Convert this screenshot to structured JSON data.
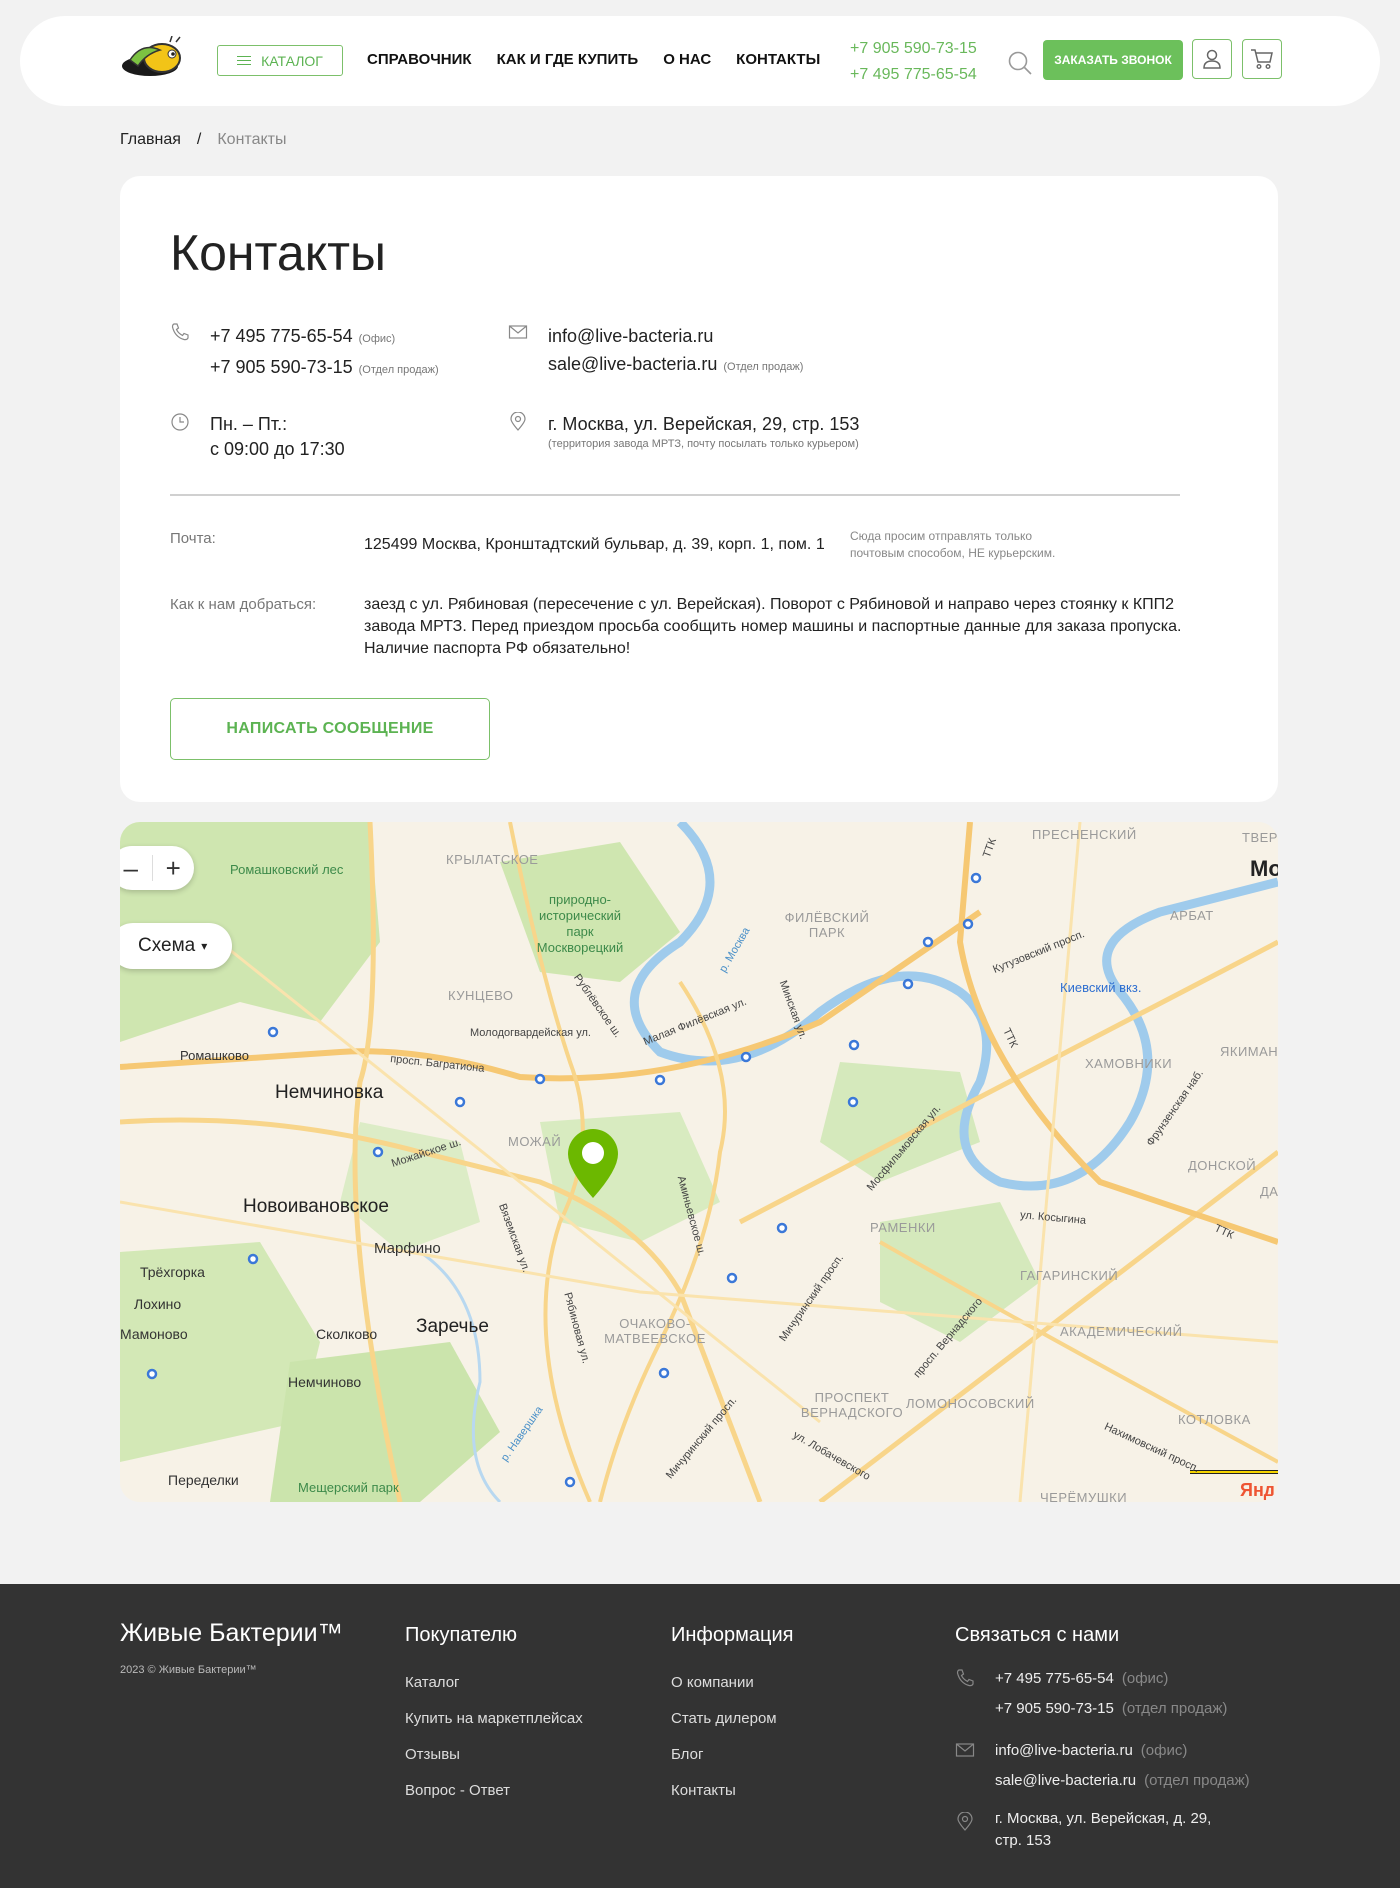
{
  "header": {
    "catalog_label": "КАТАЛОГ",
    "nav": [
      "СПРАВОЧНИК",
      "КАК И ГДЕ КУПИТЬ",
      "О НАС",
      "КОНТАКТЫ"
    ],
    "phones": [
      "+7 905 590-73-15",
      "+7 495 775-65-54"
    ],
    "call_label": "ЗАКАЗАТЬ ЗВОНОК"
  },
  "breadcrumb": {
    "home": "Главная",
    "sep": "/",
    "current": "Контакты"
  },
  "contacts": {
    "title": "Контакты",
    "phone1": "+7 495 775-65-54",
    "phone1_note": "(Офис)",
    "phone2": "+7 905 590-73-15",
    "phone2_note": "(Отдел продаж)",
    "email1": "info@live-bacteria.ru",
    "email2": "sale@live-bacteria.ru",
    "email2_note": "(Отдел продаж)",
    "hours1": "Пн. – Пт.:",
    "hours2": "с 09:00 до 17:30",
    "address": "г. Москва, ул. Верейская, 29, стр. 153",
    "address_note": "(территория завода МРТЗ, почту посылать только курьером)",
    "post_label": "Почта:",
    "post_value": "125499 Москва, Кронштадтский бульвар, д. 39, корп. 1, пом. 1",
    "post_note": "Сюда просим отправлять только почтовым способом, НЕ курьерским.",
    "route_label": "Как к нам добраться:",
    "route_value": "заезд с ул. Рябиновая (пересечение с ул. Верейская). Поворот с Рябиновой и направо через стоянку к КПП2 завода МРТЗ. Перед приездом просьба сообщить номер машины и паспортные данные для заказа пропуска. Наличие паспорта РФ обязательно!",
    "message_button": "НАПИСАТЬ СООБЩЕНИЕ"
  },
  "map": {
    "zoom_out": "–",
    "zoom_in": "+",
    "scheme_label": "Схема",
    "scheme_arrow": "▾",
    "labels": {
      "romashkovsky_les": "Ромашковский лес",
      "krylatskoe": "КРЫЛАТСКОЕ",
      "park": "природно-исторический парк Москворецкий",
      "presnensky": "ПРЕСНЕНСКИЙ",
      "tver": "ТВЕР",
      "mo": "Мо",
      "ttk1": "ТТК",
      "filevsky_park": "ФИЛЁВСКИЙ ПАРК",
      "arbat": "АРБАТ",
      "moskva_river": "р. Москва",
      "kutuzovsky": "Кутузовский просп.",
      "kievsky": "Киевский вкз.",
      "kuntsevo": "КУНЦЕВО",
      "rublevskoe": "Рублёвское ш.",
      "minskaya": "Минская ул.",
      "malaya_filevskaya": "Малая Филёвская ул.",
      "molodogvardeyskaya": "Молодогвардейская ул.",
      "ttk2": "ТТК",
      "yakiman": "ЯКИМАН",
      "romashkovo": "Ромашково",
      "bagrationa": "просп. Багратиона",
      "khamovniki": "ХАМОВНИКИ",
      "nemchinovka": "Немчиновка",
      "mozhaysky": "МОЖАЙ",
      "mozhayskoe": "Можайское ш.",
      "frunzenskaya": "Фрунзенская наб.",
      "donskoy": "ДОНСКОЙ",
      "novoivanovskoe": "Новоивановское",
      "mosfilmovskaya": "Мосфильмовская ул.",
      "aminyevskoe": "Аминьевское ш.",
      "vyazemskaya": "Вяземская ул.",
      "ramenki": "РАМЕНКИ",
      "kosygina": "ул. Косыгина",
      "ttk3": "ТТК",
      "da": "ДА",
      "marfino": "Марфино",
      "gagarinsky": "ГАГАРИНСКИЙ",
      "trekhgorka": "Трёхгорка",
      "lokhino": "Лохино",
      "michurinsky1": "Мичуринский просп.",
      "ryabinovaya": "Рябиновая ул.",
      "ochakovo": "ОЧАКОВО-МАТВЕЕВСКОЕ",
      "vernadskogo1": "просп. Вернадского",
      "akademichesky": "АКАДЕМИЧЕСКИЙ",
      "mamonovo": "Мамоново",
      "skolkovo": "Сколково",
      "zarechye": "Заречье",
      "nemchinovo": "Немчиново",
      "prospekt_vernadskogo": "ПРОСПЕКТ ВЕРНАДСКОГО",
      "lomonosovsky": "ЛОМОНОСОВСКИЙ",
      "kotlovka": "КОТЛОВКА",
      "nakhimovsky": "Нахимовский просп.",
      "michurinsky2": "Мичуринский просп.",
      "navershka": "р. Навершка",
      "lobachevskogo": "ул. Лобачевского",
      "peredelki": "Переделки",
      "meshchersky": "Мещерский парк",
      "cheremushki": "ЧЕРЁМУШКИ",
      "yandex": "Янд"
    }
  },
  "footer": {
    "brand": "Живые Бактерии™",
    "copyright": "2023 © Живые Бактерии™",
    "buyer_title": "Покупателю",
    "buyer_links": [
      "Каталог",
      "Купить на маркетплейсах",
      "Отзывы",
      "Вопрос - Ответ"
    ],
    "info_title": "Информация",
    "info_links": [
      "О компании",
      "Стать дилером",
      "Блог",
      "Контакты"
    ],
    "contact_title": "Связаться с нами",
    "phone1": "+7 495 775-65-54",
    "phone1_note": "(офис)",
    "phone2": "+7 905 590-73-15",
    "phone2_note": "(отдел продаж)",
    "email1": "info@live-bacteria.ru",
    "email1_note": "(офис)",
    "email2": "sale@live-bacteria.ru",
    "email2_note": "(отдел продаж)",
    "address": "г. Москва, ул. Верейская, д. 29, стр. 153"
  },
  "colors": {
    "accent": "#6cc05b",
    "footer_bg": "#333333",
    "page_bg": "#f2f2f2"
  }
}
